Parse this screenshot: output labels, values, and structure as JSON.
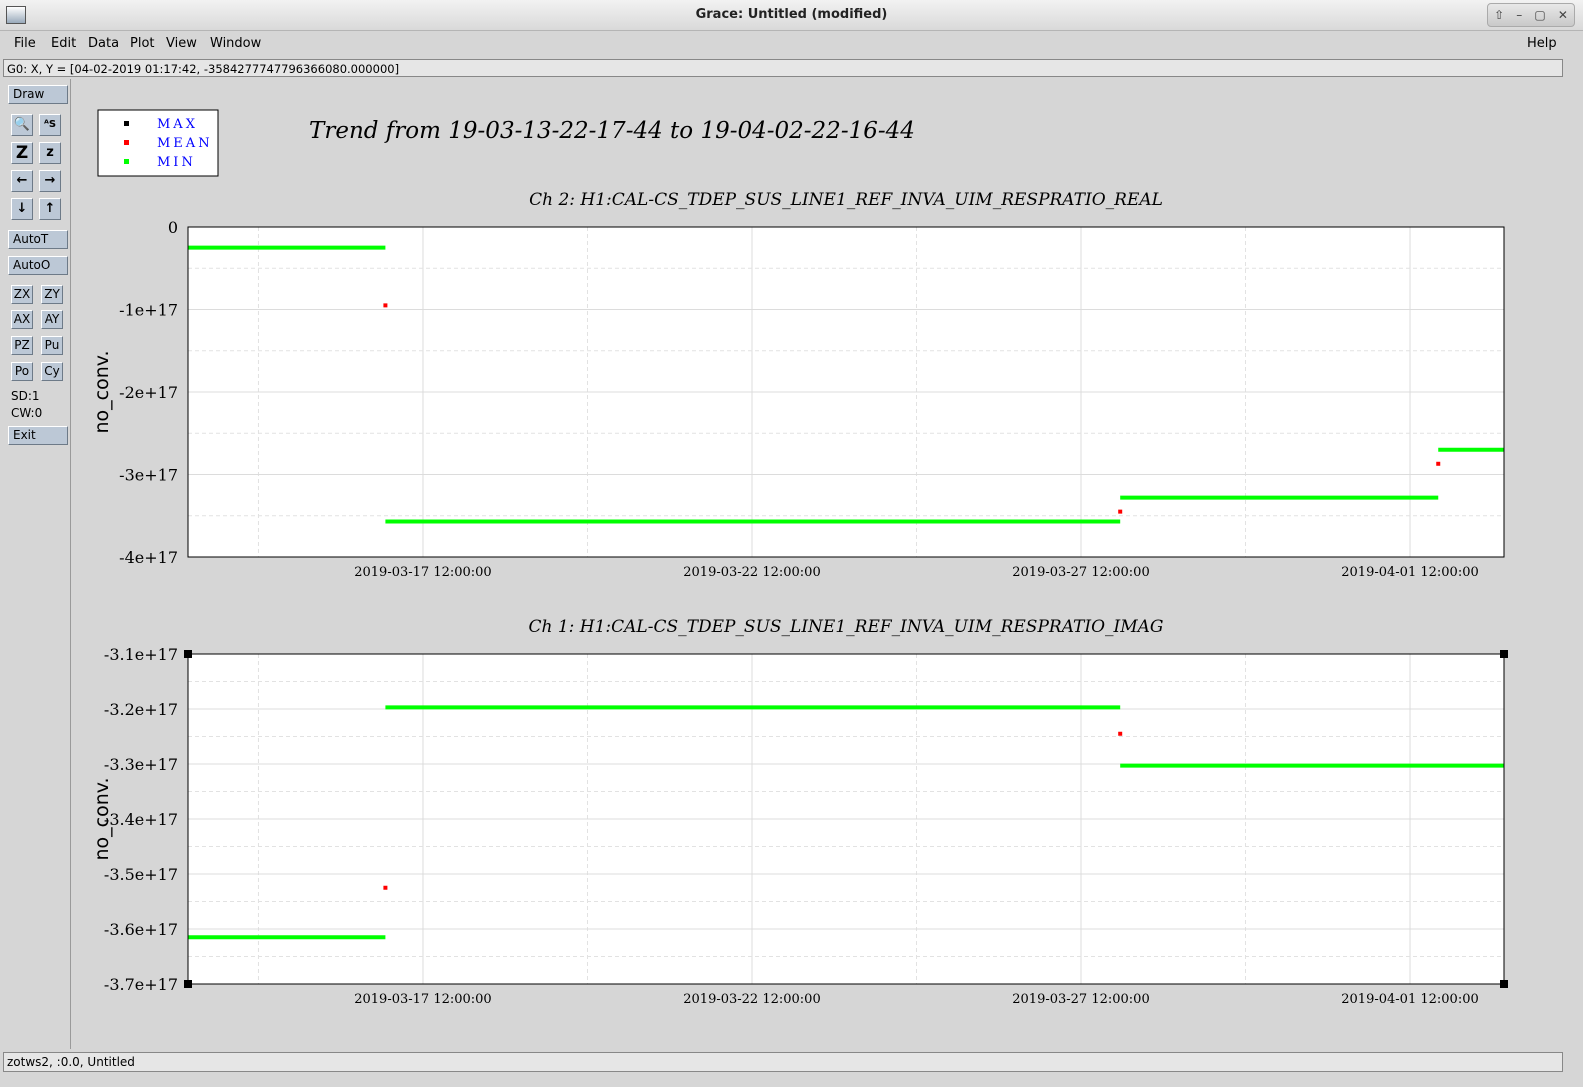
{
  "window": {
    "title": "Grace: Untitled (modified)",
    "controls": [
      "⇧",
      "–",
      "▢",
      "✕"
    ]
  },
  "menu": {
    "items": [
      "File",
      "Edit",
      "Data",
      "Plot",
      "View",
      "Window"
    ],
    "help": "Help"
  },
  "locator": "G0: X, Y = [04-02-2019 01:17:42, -3584277747796366080.000000]",
  "toolbar": {
    "draw": "Draw",
    "icon_buttons": [
      {
        "name": "zoom-icon",
        "glyph": "🔍"
      },
      {
        "name": "text-tool-icon",
        "glyph": "ᴬS"
      },
      {
        "name": "zoom-big-icon",
        "glyph": "Z"
      },
      {
        "name": "zoom-small-icon",
        "glyph": "z"
      },
      {
        "name": "arrow-left-icon",
        "glyph": "←"
      },
      {
        "name": "arrow-right-icon",
        "glyph": "→"
      },
      {
        "name": "arrow-down-icon",
        "glyph": "↓"
      },
      {
        "name": "arrow-up-icon",
        "glyph": "↑"
      }
    ],
    "autot": "AutoT",
    "autoo": "AutoO",
    "small_buttons": [
      "ZX",
      "ZY",
      "AX",
      "AY",
      "PZ",
      "Pu",
      "Po",
      "Cy"
    ],
    "sd": "SD:1",
    "cw": "CW:0",
    "exit": "Exit"
  },
  "footer": "zotws2, :0.0, Untitled",
  "legend": [
    {
      "label": "MAX",
      "color": "#000000"
    },
    {
      "label": "MEAN",
      "color": "#ff0000"
    },
    {
      "label": "MIN",
      "color": "#00ff00"
    }
  ],
  "trend_title": "Trend from 19-03-13-22-17-44 to 19-04-02-22-16-44",
  "chart_data": [
    {
      "type": "line",
      "title": "Ch 2: H1:CAL-CS_TDEP_SUS_LINE1_REF_INVA_UIM_RESPRATIO_REAL",
      "ylabel": "no_conv.",
      "xlim": [
        "2019-03-13 22:17:44",
        "2019-04-02 22:16:44"
      ],
      "ylim": [
        -4e+17,
        0
      ],
      "yticks": [
        0,
        -1e+17,
        -2e+17,
        -3e+17,
        -4e+17
      ],
      "ytick_labels": [
        "0",
        "-1e+17",
        "-2e+17",
        "-3e+17",
        "-4e+17"
      ],
      "xticks": [
        "2019-03-17 12:00:00",
        "2019-03-22 12:00:00",
        "2019-03-27 12:00:00",
        "2019-04-01 12:00:00"
      ],
      "minor_grid": true,
      "series": [
        {
          "name": "MIN",
          "color": "#00ff00",
          "segments": [
            {
              "x0": "2019-03-13 22:17:44",
              "x1": "2019-03-16 22:17:44",
              "y": -2.5e+16
            },
            {
              "x0": "2019-03-16 22:17:44",
              "x1": "2019-03-28 02:17:44",
              "y": -3.57e+17
            },
            {
              "x0": "2019-03-28 02:17:44",
              "x1": "2019-04-01 22:17:44",
              "y": -3.28e+17
            },
            {
              "x0": "2019-04-01 22:17:44",
              "x1": "2019-04-02 22:16:44",
              "y": -2.7e+17
            }
          ]
        },
        {
          "name": "MEAN",
          "color": "#ff0000",
          "points": [
            {
              "x": "2019-03-16 22:17:44",
              "y": -9.5e+16
            },
            {
              "x": "2019-03-28 02:17:44",
              "y": -3.45e+17
            },
            {
              "x": "2019-04-01 22:17:44",
              "y": -2.87e+17
            }
          ]
        }
      ]
    },
    {
      "type": "line",
      "title": "Ch 1: H1:CAL-CS_TDEP_SUS_LINE1_REF_INVA_UIM_RESPRATIO_IMAG",
      "ylabel": "no_conv.",
      "xlim": [
        "2019-03-13 22:17:44",
        "2019-04-02 22:16:44"
      ],
      "ylim": [
        -3.7e+17,
        -3.1e+17
      ],
      "yticks": [
        -3.1e+17,
        -3.2e+17,
        -3.3e+17,
        -3.4e+17,
        -3.5e+17,
        -3.6e+17,
        -3.7e+17
      ],
      "ytick_labels": [
        "-3.1e+17",
        "-3.2e+17",
        "-3.3e+17",
        "-3.4e+17",
        "-3.5e+17",
        "-3.6e+17",
        "-3.7e+17"
      ],
      "xticks": [
        "2019-03-17 12:00:00",
        "2019-03-22 12:00:00",
        "2019-03-27 12:00:00",
        "2019-04-01 12:00:00"
      ],
      "minor_grid": true,
      "series": [
        {
          "name": "MIN",
          "color": "#00ff00",
          "segments": [
            {
              "x0": "2019-03-13 22:17:44",
              "x1": "2019-03-16 22:17:44",
              "y": -3.615e+17
            },
            {
              "x0": "2019-03-16 22:17:44",
              "x1": "2019-03-28 02:17:44",
              "y": -3.197e+17
            },
            {
              "x0": "2019-03-28 02:17:44",
              "x1": "2019-04-02 22:16:44",
              "y": -3.303e+17
            }
          ]
        },
        {
          "name": "MEAN",
          "color": "#ff0000",
          "points": [
            {
              "x": "2019-03-16 22:17:44",
              "y": -3.525e+17
            },
            {
              "x": "2019-03-28 02:17:44",
              "y": -3.245e+17
            }
          ]
        }
      ]
    }
  ]
}
